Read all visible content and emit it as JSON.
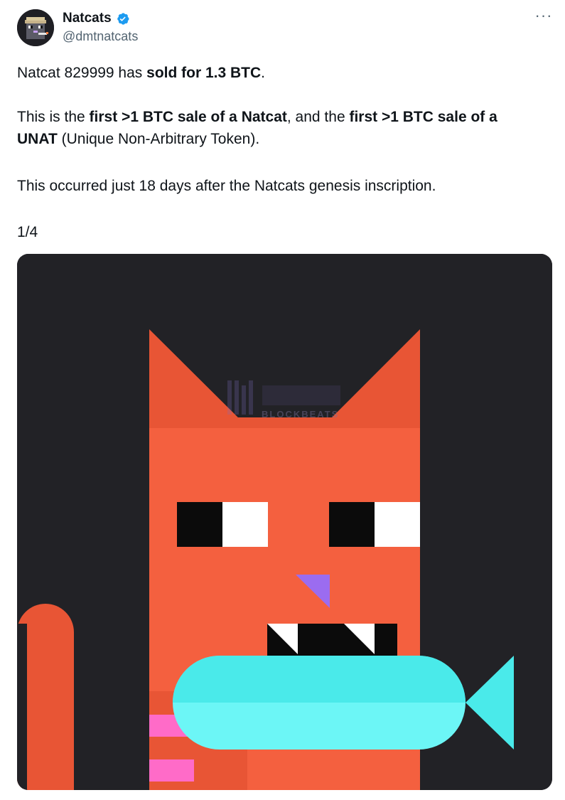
{
  "author": {
    "display_name": "Natcats",
    "handle": "@dmtnatcats",
    "verified": true,
    "avatar_icon": "pixel-cat-avatar-icon"
  },
  "more_menu": {
    "label": "···",
    "icon": "more-options-icon"
  },
  "tweet": {
    "p1": {
      "t1": "Natcat 829999 has ",
      "b1": "sold for 1.3 BTC",
      "t2": "."
    },
    "p2": {
      "t1": "This is the ",
      "b1": "first >1 BTC sale of a Natcat",
      "t2": ", and the ",
      "b2": "first >1 BTC sale of a",
      "b3": "UNAT",
      "t3": " (Unique Non-Arbitrary Token)."
    },
    "p3": "This occurred just 18 days after the Natcats genesis inscription.",
    "p4": "1/4"
  },
  "media": {
    "watermark": "BLOCKBEATS",
    "colors": {
      "background": "#222226",
      "cat_body": "#f4603f",
      "cat_dark": "#e85535",
      "fish": "#6cf6f6",
      "fish_dark": "#4aeaea",
      "nose": "#9b6cf0",
      "pink": "#ff6bc8"
    }
  }
}
